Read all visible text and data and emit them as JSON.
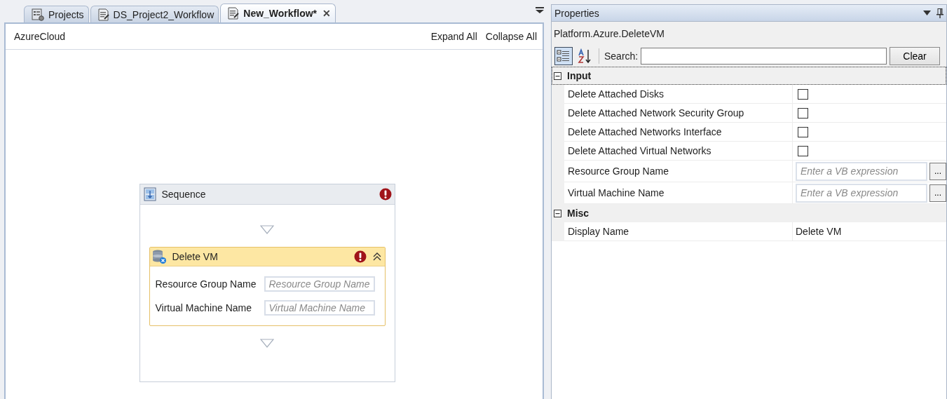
{
  "tabs": [
    {
      "label": "Projects",
      "kind": "projects",
      "selected": false
    },
    {
      "label": "DS_Project2_Workflow",
      "kind": "document",
      "selected": false
    },
    {
      "label": "New_Workflow*",
      "kind": "document",
      "selected": true,
      "close": "✕"
    }
  ],
  "designer": {
    "breadcrumb": "AzureCloud",
    "expand_all": "Expand All",
    "collapse_all": "Collapse All",
    "sequence": {
      "title": "Sequence",
      "error": true,
      "activity": {
        "title": "Delete VM",
        "error": true,
        "expanded": true,
        "fields": [
          {
            "label": "Resource Group Name",
            "placeholder": "Resource Group Name"
          },
          {
            "label": "Virtual Machine Name",
            "placeholder": "Virtual Machine Name"
          }
        ]
      }
    }
  },
  "properties": {
    "title": "Properties",
    "type_name": "Platform.Azure.DeleteVM",
    "categorized": true,
    "search_label": "Search:",
    "clear": "Clear",
    "categories": [
      {
        "name": "Input",
        "expanded": true,
        "focused": true,
        "rows": [
          {
            "name": "Delete Attached Disks",
            "kind": "checkbox",
            "checked": false
          },
          {
            "name": "Delete Attached Network Security Group",
            "kind": "checkbox",
            "checked": false
          },
          {
            "name": "Delete Attached Networks Interface",
            "kind": "checkbox",
            "checked": false
          },
          {
            "name": "Delete Attached Virtual Networks",
            "kind": "checkbox",
            "checked": false
          },
          {
            "name": "Resource Group Name",
            "kind": "expression",
            "placeholder": "Enter a VB expression",
            "button": "..."
          },
          {
            "name": "Virtual Machine Name",
            "kind": "expression",
            "placeholder": "Enter a VB expression",
            "button": "..."
          }
        ]
      },
      {
        "name": "Misc",
        "expanded": true,
        "focused": false,
        "rows": [
          {
            "name": "Display Name",
            "kind": "text",
            "value": "Delete VM"
          }
        ]
      }
    ]
  }
}
